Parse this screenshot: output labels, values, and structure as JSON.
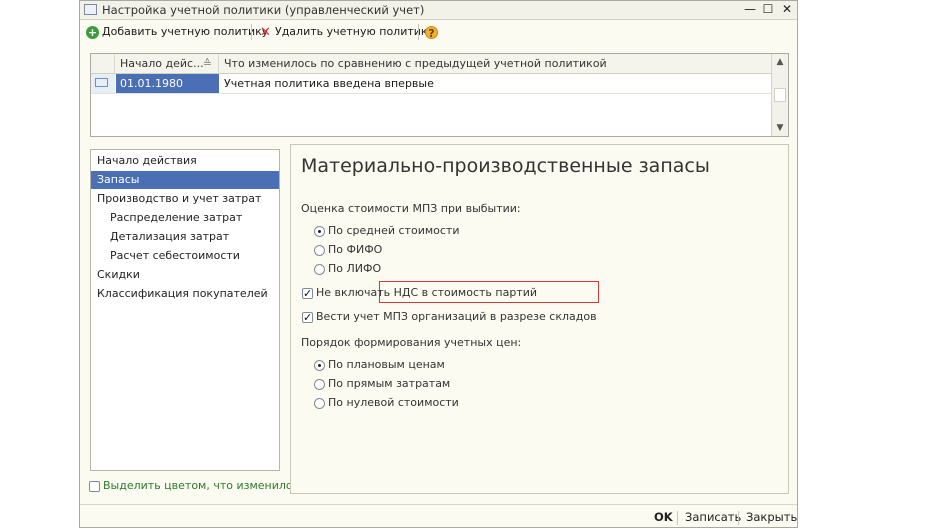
{
  "window": {
    "title": "Настройка учетной политики (управленческий учет)"
  },
  "toolbar": {
    "add_label": "Добавить учетную политику",
    "delete_label": "Удалить учетную политику",
    "help_label": "?"
  },
  "grid": {
    "columns": [
      "Начало дейс...",
      "Что изменилось по сравнению с предыдущей учетной политикой"
    ],
    "rows": [
      {
        "date": "01.01.1980",
        "description": "Учетная политика введена впервые"
      }
    ]
  },
  "nav": {
    "items": [
      {
        "label": "Начало действия"
      },
      {
        "label": "Запасы"
      },
      {
        "label": "Производство и учет затрат"
      },
      {
        "label": "Распределение затрат"
      },
      {
        "label": "Детализация затрат"
      },
      {
        "label": "Расчет себестоимости"
      },
      {
        "label": "Скидки"
      },
      {
        "label": "Классификация покупателей"
      }
    ]
  },
  "highlight_changes_label": "Выделить цветом, что изменилось",
  "panel": {
    "title": "Материально-производственные запасы",
    "valuation_label": "Оценка стоимости МПЗ при выбытии:",
    "valuation_options": [
      "По средней стоимости",
      "По ФИФО",
      "По ЛИФО"
    ],
    "valuation_selected": "По средней стоимости",
    "exclude_vat_label": "Не включать НДС в стоимость партий",
    "exclude_vat_checked": true,
    "warehouse_label": "Вести учет МПЗ организаций в разрезе складов",
    "warehouse_checked": true,
    "pricing_label": "Порядок формирования учетных цен:",
    "pricing_options": [
      "По плановым ценам",
      "По прямым затратам",
      "По нулевой стоимости"
    ],
    "pricing_selected": "По плановым ценам"
  },
  "footer": {
    "ok_label": "OK",
    "save_label": "Записать",
    "close_label": "Закрыть"
  },
  "colors": {
    "selection": "#4a6fb5",
    "highlight_border": "#d43a3a",
    "green_text": "#2b7d2b"
  }
}
